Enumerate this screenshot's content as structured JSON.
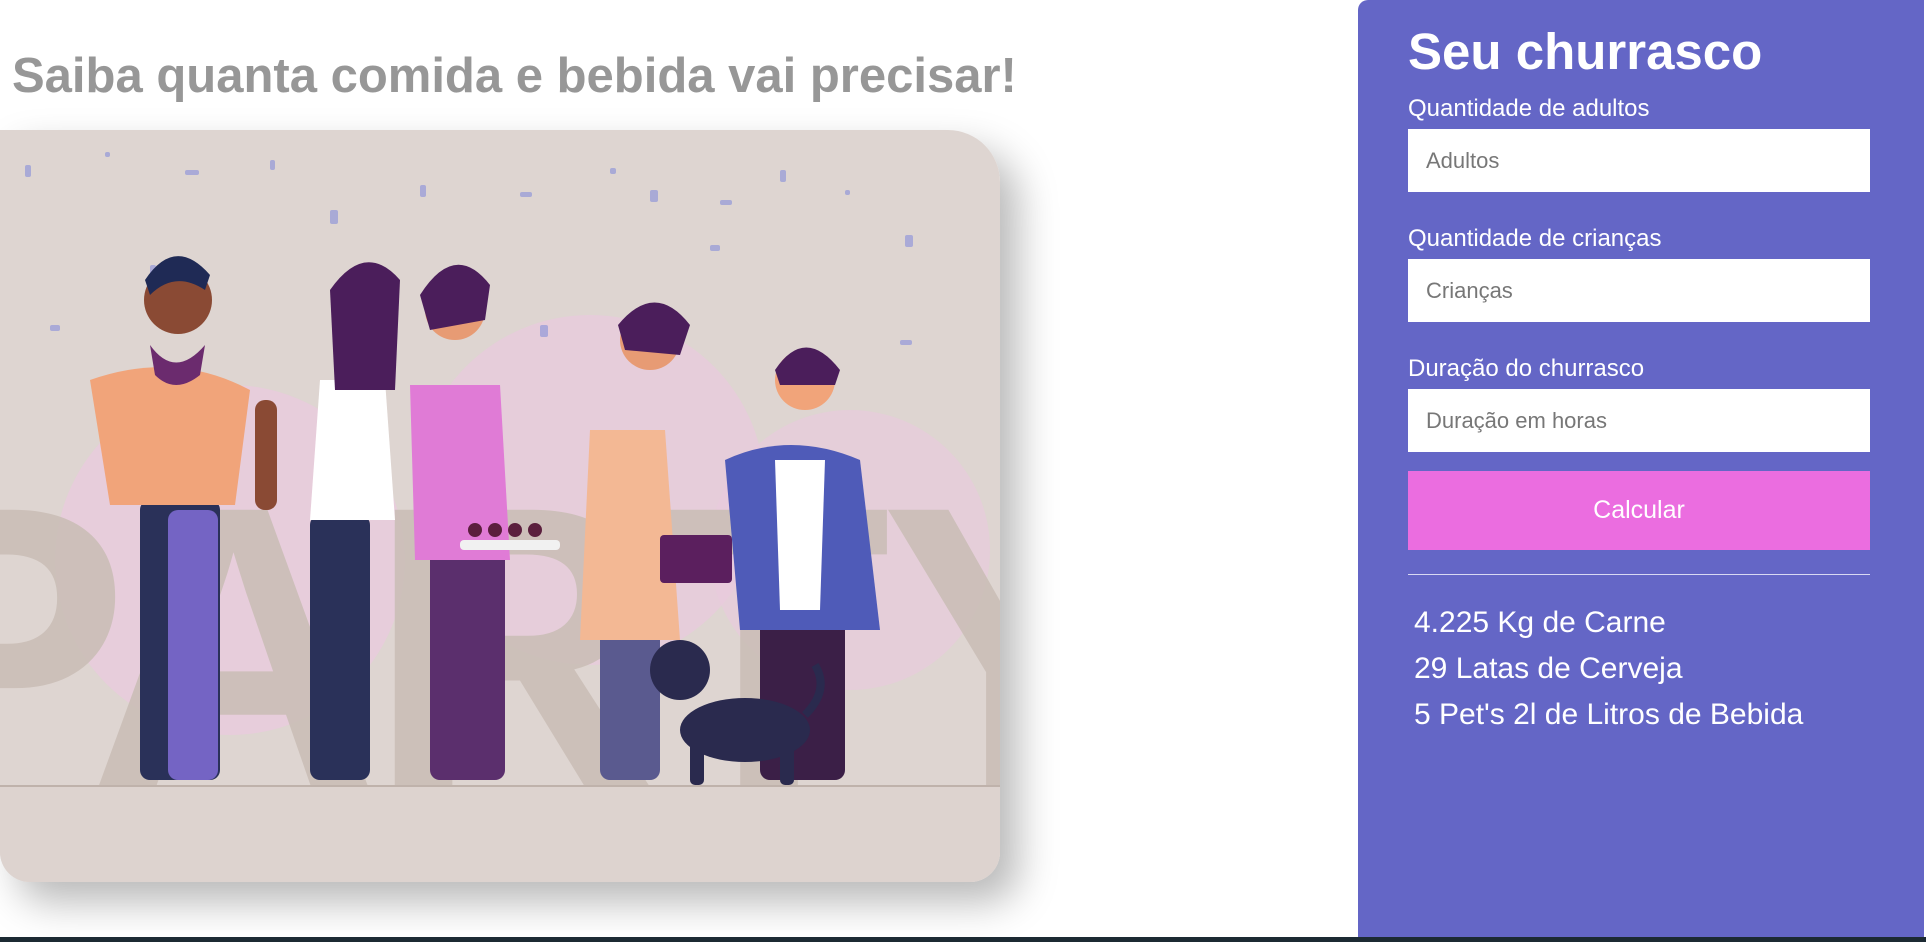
{
  "page": {
    "headline": "Saiba quanta comida e bebida vai precisar!"
  },
  "illustration": {
    "alt": "PARTY",
    "word": "PARTY"
  },
  "panel": {
    "title": "Seu churrasco",
    "fields": [
      {
        "label": "Quantidade de adultos",
        "placeholder": "Adultos",
        "value": ""
      },
      {
        "label": "Quantidade de crianças",
        "placeholder": "Crianças",
        "value": ""
      },
      {
        "label": "Duração do churrasco",
        "placeholder": "Duração em horas",
        "value": ""
      }
    ],
    "button_label": "Calcular",
    "results": [
      "4.225 Kg de Carne",
      "29 Latas de Cerveja",
      "5 Pet's 2l de Litros de Bebida"
    ]
  },
  "colors": {
    "panel_bg": "#6466c6",
    "button_bg": "#eb6de0",
    "headline": "#979797",
    "illustration_bg": "#ded5d1"
  }
}
